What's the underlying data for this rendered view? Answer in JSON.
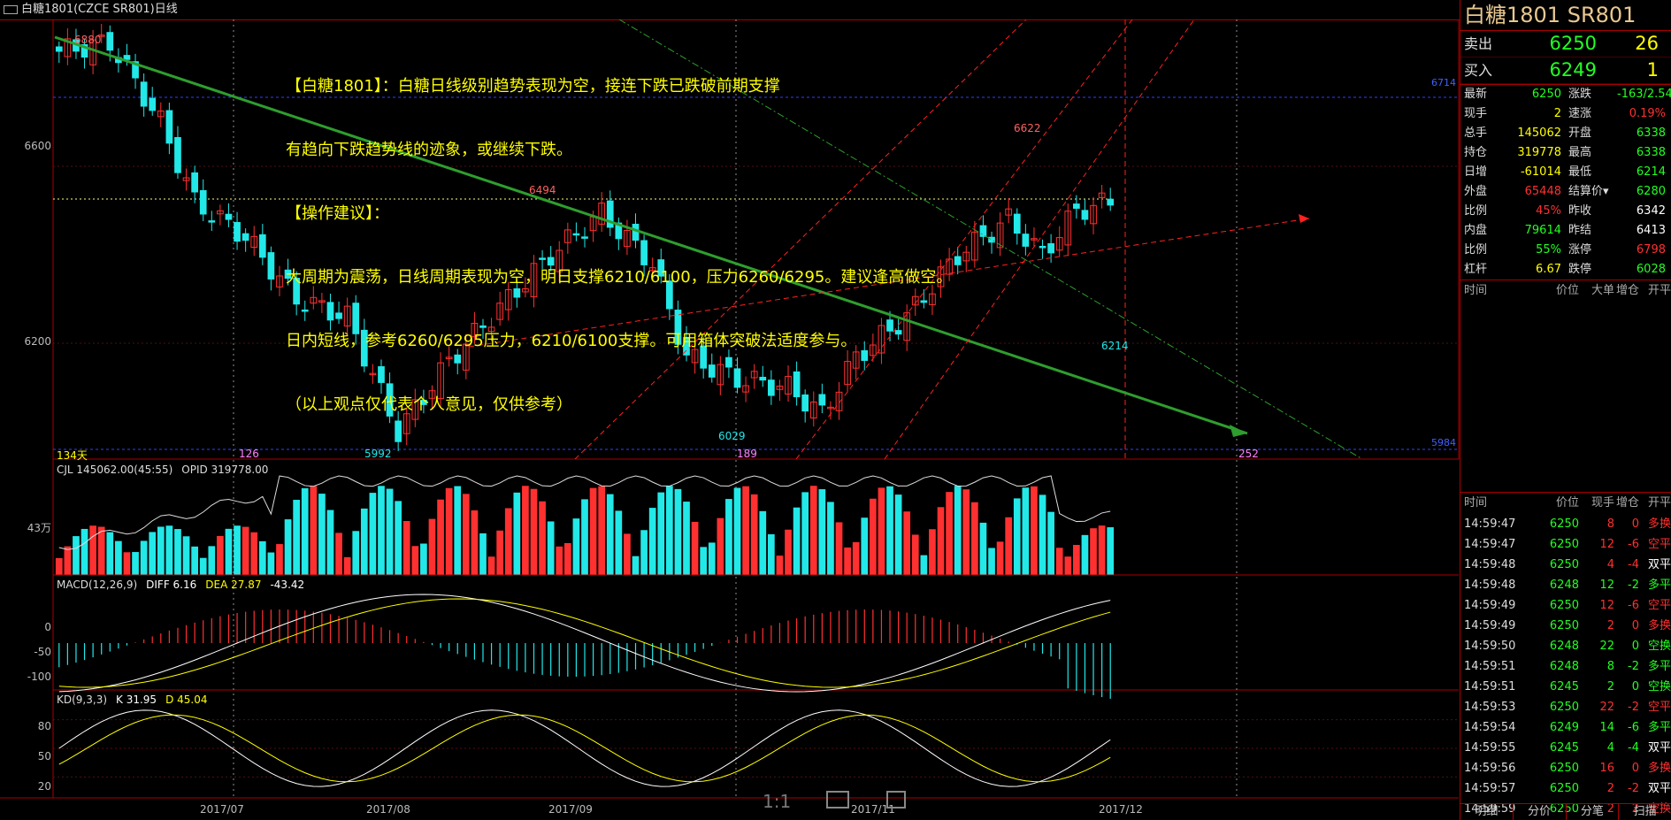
{
  "window": {
    "title": "白糖1801(CZCE SR801)日线"
  },
  "annotation": {
    "lines": [
      "【白糖1801】：白糖日线级别趋势表现为空，接连下跌已跌破前期支撑",
      "有趋向下跌趋势线的迹象，或继续下跌。",
      "【操作建议】：",
      "大周期为震荡，日线周期表现为空，明日支撑6210/6100，压力6260/6295。建议逢高做空。",
      "日内短线，参考6260/6295压力，6210/6100支撑。可用箱体突破法适度参与。",
      "（以上观点仅代表个人意见，仅供参考）"
    ]
  },
  "main_chart": {
    "y_ticks": [
      "6600",
      "6200"
    ],
    "price_labels": {
      "high1": "6880",
      "p1": "6494",
      "p2": "6622",
      "low1": "5992",
      "low2": "6029",
      "last": "6214",
      "right_top": "6714",
      "right_bottom": "5984"
    },
    "day_labels": [
      "134天",
      "126",
      "189",
      "252"
    ]
  },
  "volume_panel": {
    "label_cjl": "CJL 145062.00(45:55)",
    "label_opid": "OPID 319778.00",
    "y_tick": "43万"
  },
  "macd_panel": {
    "label": "MACD(12,26,9)",
    "diff": "DIFF 6.16",
    "dea": "DEA 27.87",
    "macd": "-43.42",
    "y_ticks": [
      "0",
      "-50",
      "-100"
    ]
  },
  "kd_panel": {
    "label": "KD(9,3,3)",
    "k": "K 31.95",
    "d": "D 45.04",
    "y_ticks": [
      "80",
      "50",
      "20"
    ]
  },
  "x_axis": [
    "2017/07",
    "2017/08",
    "2017/09",
    "2017/11",
    "2017/12"
  ],
  "zoom_controls": {
    "ratio": "1:1"
  },
  "quote": {
    "title": "白糖1801  SR801",
    "sell": {
      "label": "卖出",
      "price": "6250",
      "vol": "26"
    },
    "buy": {
      "label": "买入",
      "price": "6249",
      "vol": "1"
    }
  },
  "stats": [
    {
      "k": "最新",
      "v": "6250",
      "vc": "#22ff22",
      "k2": "涨跌",
      "v2": "-163/2.54%",
      "v2c": "#22ff22"
    },
    {
      "k": "现手",
      "v": "2",
      "vc": "#ffff00",
      "k2": "速涨",
      "v2": "0.19%",
      "v2c": "#ff3030"
    },
    {
      "k": "总手",
      "v": "145062",
      "vc": "#ffff00",
      "k2": "开盘",
      "v2": "6338",
      "v2c": "#22ff22"
    },
    {
      "k": "持仓",
      "v": "319778",
      "vc": "#ffff00",
      "k2": "最高",
      "v2": "6338",
      "v2c": "#22ff22"
    },
    {
      "k": "日增",
      "v": "-61014",
      "vc": "#ffff00",
      "k2": "最低",
      "v2": "6214",
      "v2c": "#22ff22"
    },
    {
      "k": "外盘",
      "v": "65448",
      "vc": "#ff3030",
      "k2": "结算价▾",
      "v2": "6280",
      "v2c": "#22ff22"
    },
    {
      "k": "比例",
      "v": "45%",
      "vc": "#ff3030",
      "k2": "昨收",
      "v2": "6342",
      "v2c": "#ffffff"
    },
    {
      "k": "内盘",
      "v": "79614",
      "vc": "#22ff22",
      "k2": "昨结",
      "v2": "6413",
      "v2c": "#ffffff"
    },
    {
      "k": "比例",
      "v": "55%",
      "vc": "#22ff22",
      "k2": "涨停",
      "v2": "6798",
      "v2c": "#ff3030"
    },
    {
      "k": "杠杆",
      "v": "6.67",
      "vc": "#ffff00",
      "k2": "跌停",
      "v2": "6028",
      "v2c": "#22ff22"
    }
  ],
  "big_order_header": [
    "时间",
    "价位",
    "大单",
    "增仓",
    "开平"
  ],
  "tick_header": [
    "时间",
    "价位",
    "现手",
    "增仓",
    "开平"
  ],
  "ticks": [
    {
      "t": "14:59:47",
      "p": "6250",
      "v": "8",
      "vc": "#ff3030",
      "oi": "0",
      "ty": "多换",
      "tyc": "#ff3030"
    },
    {
      "t": "14:59:47",
      "p": "6250",
      "v": "12",
      "vc": "#ff3030",
      "oi": "-6",
      "ty": "空平",
      "tyc": "#ff3030"
    },
    {
      "t": "14:59:48",
      "p": "6250",
      "v": "4",
      "vc": "#ff3030",
      "oi": "-4",
      "ty": "双平",
      "tyc": "#ffffff"
    },
    {
      "t": "14:59:48",
      "p": "6248",
      "v": "12",
      "vc": "#22ff22",
      "oi": "-2",
      "ty": "多平",
      "tyc": "#22ff22"
    },
    {
      "t": "14:59:49",
      "p": "6250",
      "v": "12",
      "vc": "#ff3030",
      "oi": "-6",
      "ty": "空平",
      "tyc": "#ff3030"
    },
    {
      "t": "14:59:49",
      "p": "6250",
      "v": "2",
      "vc": "#ff3030",
      "oi": "0",
      "ty": "多换",
      "tyc": "#ff3030"
    },
    {
      "t": "14:59:50",
      "p": "6248",
      "v": "22",
      "vc": "#22ff22",
      "oi": "0",
      "ty": "空换",
      "tyc": "#22ff22"
    },
    {
      "t": "14:59:51",
      "p": "6248",
      "v": "8",
      "vc": "#22ff22",
      "oi": "-2",
      "ty": "多平",
      "tyc": "#22ff22"
    },
    {
      "t": "14:59:51",
      "p": "6245",
      "v": "2",
      "vc": "#22ff22",
      "oi": "0",
      "ty": "空换",
      "tyc": "#22ff22"
    },
    {
      "t": "14:59:53",
      "p": "6250",
      "v": "22",
      "vc": "#ff3030",
      "oi": "-2",
      "ty": "空平",
      "tyc": "#ff3030"
    },
    {
      "t": "14:59:54",
      "p": "6249",
      "v": "14",
      "vc": "#22ff22",
      "oi": "-6",
      "ty": "多平",
      "tyc": "#22ff22"
    },
    {
      "t": "14:59:55",
      "p": "6245",
      "v": "4",
      "vc": "#22ff22",
      "oi": "-4",
      "ty": "双平",
      "tyc": "#ffffff"
    },
    {
      "t": "14:59:56",
      "p": "6250",
      "v": "16",
      "vc": "#ff3030",
      "oi": "0",
      "ty": "多换",
      "tyc": "#ff3030"
    },
    {
      "t": "14:59:57",
      "p": "6250",
      "v": "2",
      "vc": "#ff3030",
      "oi": "-2",
      "ty": "双平",
      "tyc": "#ffffff"
    },
    {
      "t": "14:59:59",
      "p": "6250",
      "v": "2",
      "vc": "#ff3030",
      "oi": "2",
      "ty": "空换",
      "tyc": "#ff3030"
    }
  ],
  "bottom_tabs": [
    "明细",
    "分价",
    "分笔",
    "扫描"
  ],
  "colors": {
    "up": "#ff3030",
    "down": "#22e8e8",
    "trend": "#2e9e2e",
    "accent": "#ffff00"
  }
}
